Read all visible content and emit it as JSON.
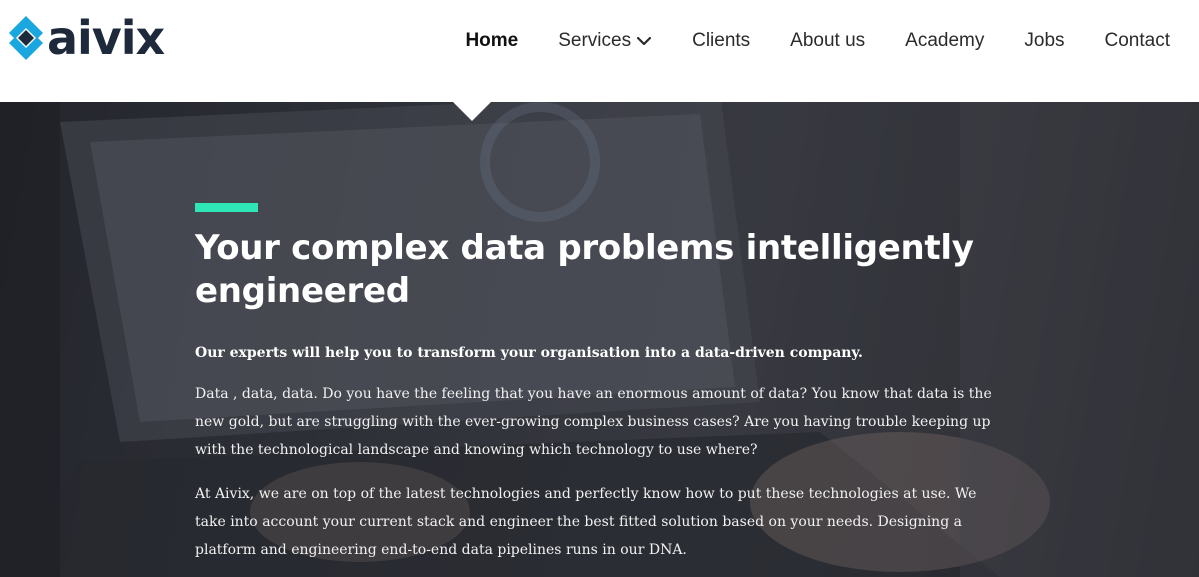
{
  "brand": {
    "name": "aivix",
    "colors": {
      "accent": "#2ee6b6",
      "logo_blue": "#1aa7e0",
      "logo_dark": "#1e2a3c"
    }
  },
  "nav": {
    "items": [
      {
        "label": "Home",
        "active": true
      },
      {
        "label": "Services",
        "has_dropdown": true
      },
      {
        "label": "Clients"
      },
      {
        "label": "About us"
      },
      {
        "label": "Academy"
      },
      {
        "label": "Jobs"
      },
      {
        "label": "Contact"
      }
    ]
  },
  "hero": {
    "title": "Your complex data problems intelligently engineered",
    "lead": "Our experts will help you to transform your organisation into a data-driven company.",
    "paragraphs": [
      "Data , data, data. Do you have the feeling that you have an enormous amount of data? You know that data is the new gold, but are struggling with the ever-growing complex business cases? Are you having trouble keeping up with the technological landscape and knowing which technology to use where?",
      "At Aivix, we are on top of the latest technologies and perfectly know how to put these technologies at use. We take into account your current stack and engineer the best fitted solution based on your needs. Designing a platform and engineering end-to-end data pipelines runs in our DNA."
    ]
  }
}
